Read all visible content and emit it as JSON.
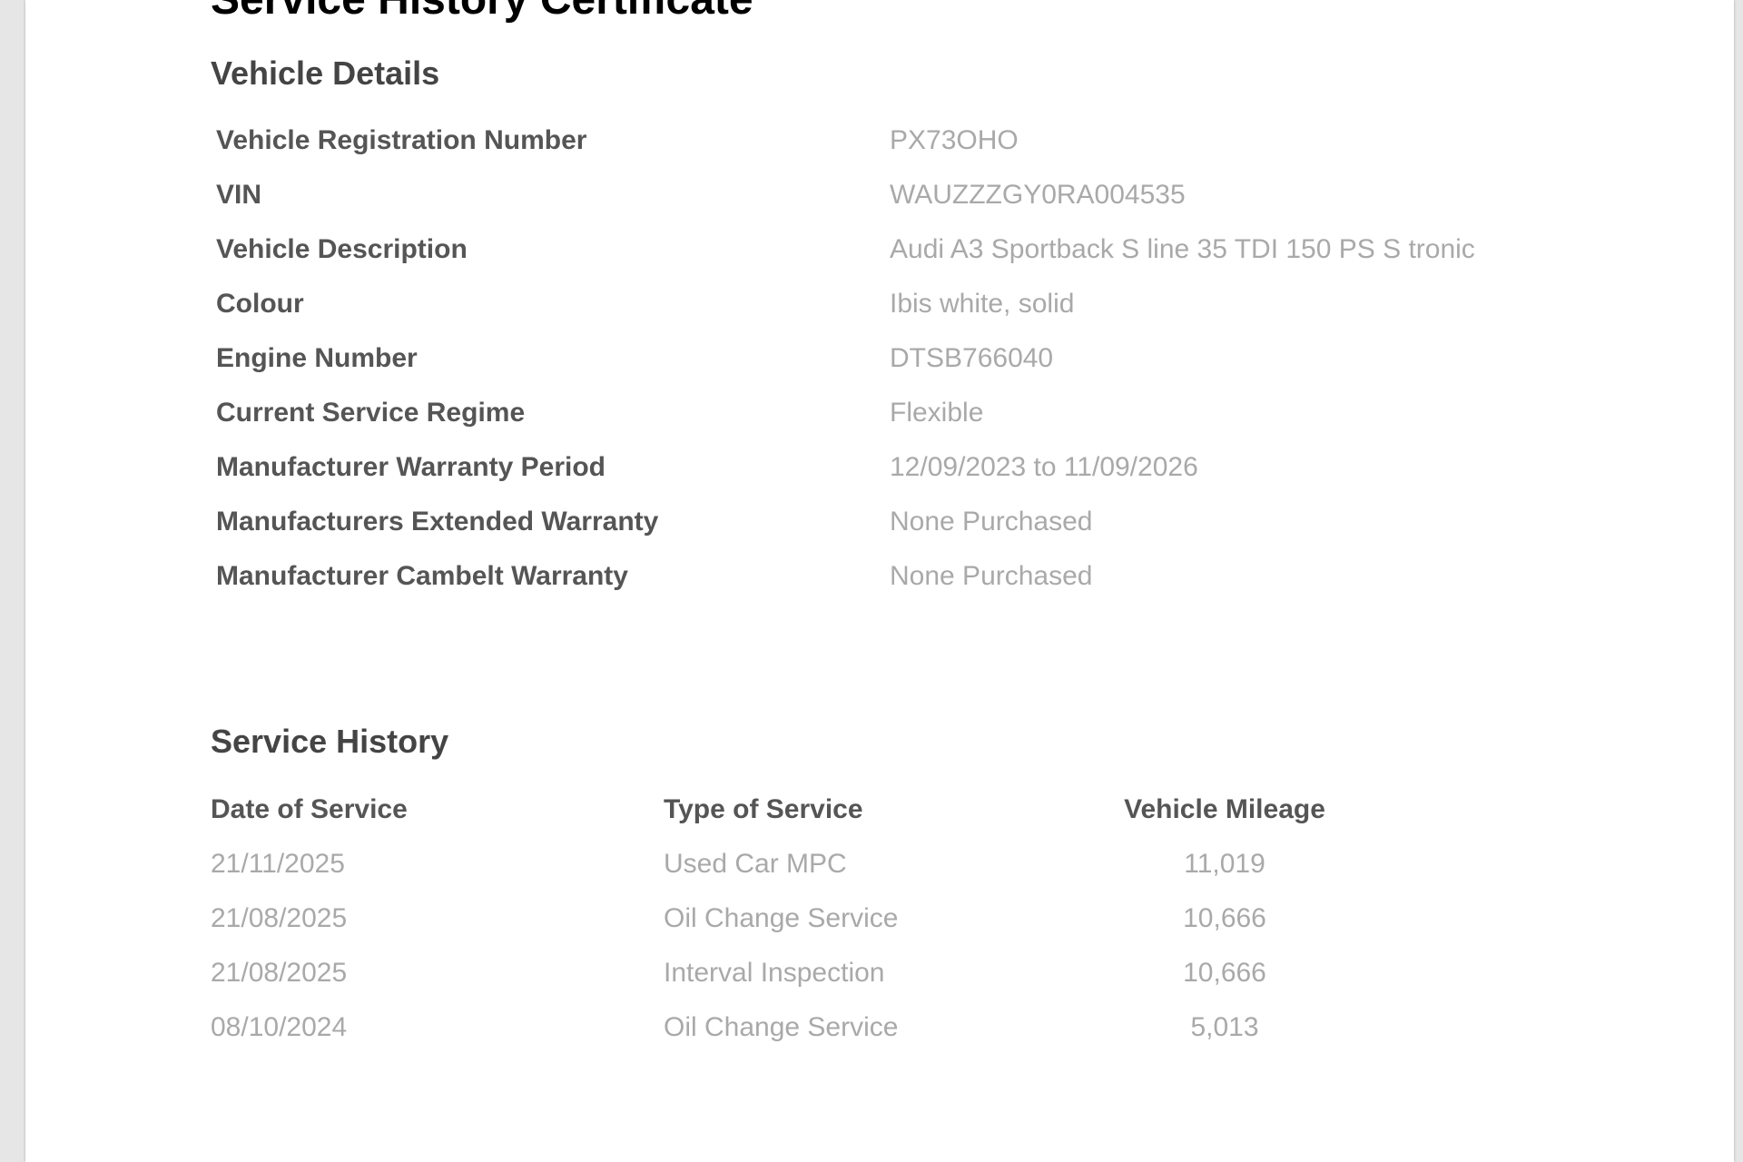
{
  "title": "Service History Certificate",
  "vehicle_details": {
    "heading": "Vehicle Details",
    "rows": [
      {
        "label": "Vehicle Registration Number",
        "value": "PX73OHO"
      },
      {
        "label": "VIN",
        "value": "WAUZZZGY0RA004535"
      },
      {
        "label": "Vehicle Description",
        "value": "Audi A3 Sportback S line 35 TDI  150 PS S tronic"
      },
      {
        "label": "Colour",
        "value": "Ibis white, solid"
      },
      {
        "label": "Engine Number",
        "value": "DTSB766040"
      },
      {
        "label": "Current Service Regime",
        "value": "Flexible"
      },
      {
        "label": "Manufacturer Warranty Period",
        "value": "12/09/2023 to 11/09/2026"
      },
      {
        "label": "Manufacturers Extended Warranty",
        "value": "None Purchased"
      },
      {
        "label": "Manufacturer Cambelt Warranty",
        "value": "None Purchased"
      }
    ]
  },
  "service_history": {
    "heading": "Service History",
    "columns": {
      "date": "Date of Service",
      "type": "Type of Service",
      "mileage": "Vehicle Mileage"
    },
    "rows": [
      {
        "date": "21/11/2025",
        "type": "Used Car MPC",
        "mileage": "11,019"
      },
      {
        "date": "21/08/2025",
        "type": "Oil Change Service",
        "mileage": "10,666"
      },
      {
        "date": "21/08/2025",
        "type": "Interval Inspection",
        "mileage": "10,666"
      },
      {
        "date": "08/10/2024",
        "type": "Oil Change Service",
        "mileage": "5,013"
      }
    ]
  }
}
